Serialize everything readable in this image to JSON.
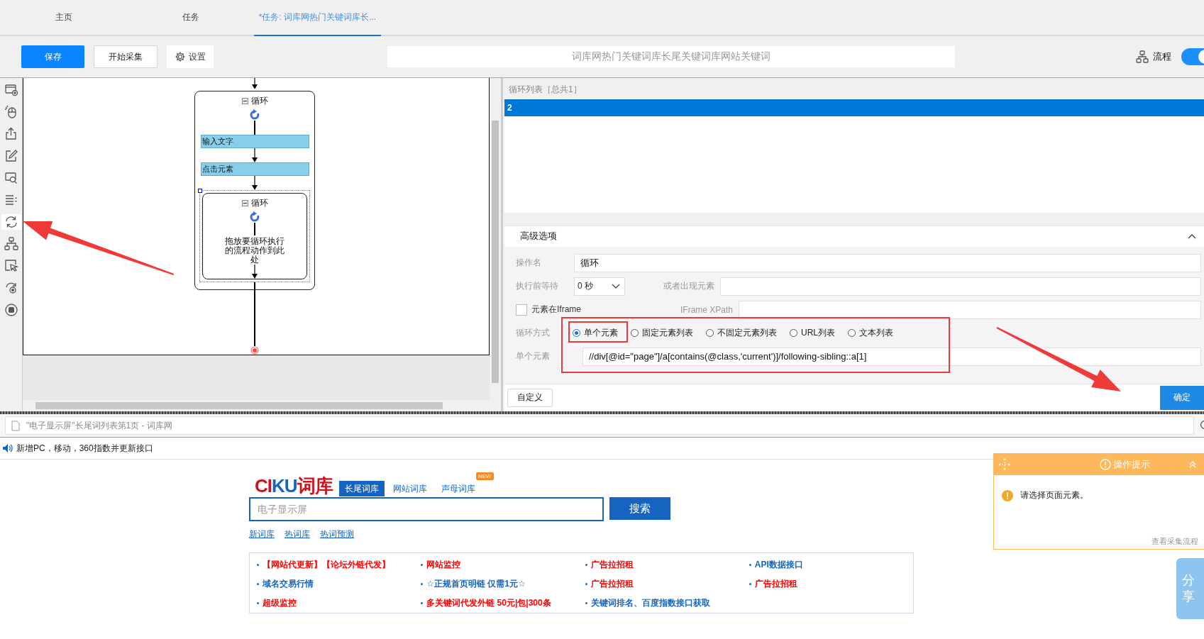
{
  "tabs": [
    {
      "label": "主页",
      "selected": false
    },
    {
      "label": "任务",
      "selected": false
    },
    {
      "label": "*任务: 词库网热门关键词库长...",
      "selected": true
    }
  ],
  "toolbar": {
    "buttons": [
      {
        "label": "保存",
        "kind": "primary"
      },
      {
        "label": "开始采集",
        "kind": "default"
      },
      {
        "label": "设置",
        "kind": "settings"
      }
    ],
    "task_title": "词库网热门关键词库长尾关键词库网站关键词",
    "flow_label": "流程",
    "flow_toggle": {
      "on": true
    }
  },
  "tool_strip": [
    {
      "kind": "page",
      "selected": false
    },
    {
      "kind": "mouse",
      "selected": false
    },
    {
      "kind": "export",
      "selected": false
    },
    {
      "kind": "edit",
      "selected": false
    },
    {
      "kind": "screen",
      "selected": false
    },
    {
      "kind": "list",
      "selected": false
    },
    {
      "kind": "loop",
      "selected": true
    },
    {
      "kind": "tree",
      "selected": false
    },
    {
      "kind": "cursor",
      "selected": false
    },
    {
      "kind": "rotate",
      "selected": false
    },
    {
      "kind": "stop",
      "selected": false
    }
  ],
  "flow": [
    {
      "kind": "loop",
      "label": "循环",
      "expanded": true,
      "children": [
        {
          "kind": "action",
          "label": "输入文字"
        },
        {
          "kind": "action",
          "label": "点击元素"
        },
        {
          "kind": "loop",
          "label": "循环",
          "expanded": true,
          "selected": true,
          "placeholder": "拖放要循环执行的流程动作到此处"
        }
      ]
    }
  ],
  "loop_list": {
    "header": "循环列表［总共1］",
    "rows": [
      {
        "text": "2",
        "selected": true
      }
    ]
  },
  "advanced": {
    "title": "高级选项",
    "expanded": true,
    "operation_name": {
      "label": "操作名",
      "value": "循环"
    },
    "wait": {
      "label": "执行前等待",
      "value": "0 秒"
    },
    "appear_element": {
      "label": "或者出现元素"
    },
    "iframe": {
      "label": "元素在Iframe",
      "checked": false
    },
    "iframe_xpath": {
      "label": "IFrame XPath"
    },
    "loop_mode": {
      "label": "循环方式",
      "options": [
        {
          "label": "单个元素",
          "selected": true
        },
        {
          "label": "固定元素列表",
          "selected": false
        },
        {
          "label": "不固定元素列表",
          "selected": false
        },
        {
          "label": "URL列表",
          "selected": false
        },
        {
          "label": "文本列表",
          "selected": false
        }
      ]
    },
    "single_element": {
      "label": "单个元素",
      "value": "//div[@id=\"page\"]/a[contains(@class,'current')]/following-sibling::a[1]"
    }
  },
  "footer": {
    "custom_button": "自定义",
    "confirm_button": "确定"
  },
  "browser": {
    "page_title": "\"电子显示屏\"长尾词列表第1页 - 词库网",
    "notice": "新增PC，移动，360指数并更新接口",
    "logo": [
      {
        "text": "CI",
        "color": "#d0111b"
      },
      {
        "text": "KU",
        "color": "#1565c0"
      },
      {
        "text": "词库",
        "color": "#d0111b"
      }
    ],
    "site_tabs": [
      {
        "label": "长尾词库",
        "selected": true
      },
      {
        "label": "网站词库",
        "selected": false
      },
      {
        "label": "声母词库",
        "selected": false,
        "badge": "NEW"
      }
    ],
    "search": {
      "placeholder": "电子显示屏",
      "button": "搜索"
    },
    "quick_links": [
      "新词库",
      "热词库",
      "热词预测"
    ],
    "link_grid": [
      {
        "text": "【网站代更新】【论坛外链代发】",
        "color": "#ff0000"
      },
      {
        "text": "网站监控",
        "color": "#ff0000"
      },
      {
        "text": "广告拉招租",
        "color": "#ff0000"
      },
      {
        "text": "API数据接口",
        "color": "#1565c0"
      },
      {
        "text": "域名交易行情",
        "color": "#1565c0"
      },
      {
        "text": "☆正规首页明链 仅需1元☆",
        "color": "#1565c0"
      },
      {
        "text": "广告拉招租",
        "color": "#ff0000"
      },
      {
        "text": "广告拉招租",
        "color": "#ff0000"
      },
      {
        "text": "超级监控",
        "color": "#ff0000"
      },
      {
        "text": "多关键词代发外链 50元|包|300条",
        "color": "#ff0000"
      },
      {
        "text": "关键词排名、百度指数接口获取",
        "color": "#1565c0"
      }
    ]
  },
  "popup": {
    "title": "操作提示",
    "message": "请选择页面元素。",
    "link": "查看采集流程"
  },
  "side_tab": "分享"
}
